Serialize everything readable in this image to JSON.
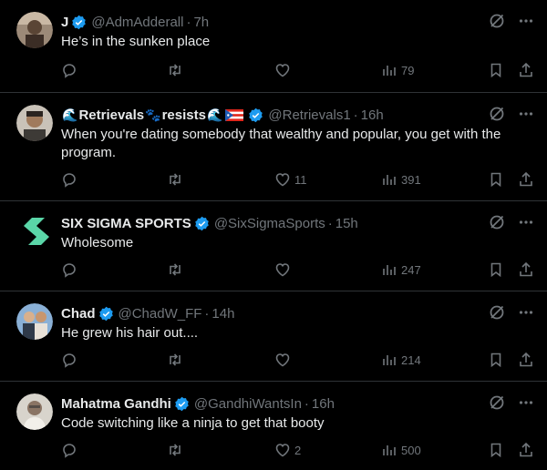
{
  "tweets": [
    {
      "name": "J",
      "handle": "@AdmAdderall",
      "time": "7h",
      "text": "He’s in the sunken place",
      "replies": "",
      "retweets": "",
      "likes": "",
      "views": "79"
    },
    {
      "name_emoji_1": "🌊",
      "name_part1": "Retrievals",
      "name_emoji_2": "🐾",
      "name_part2": "resists",
      "name_emoji_3": "🌊",
      "handle": "@Retrievals1",
      "time": "16h",
      "text": "When you're dating somebody that wealthy and popular, you get with the program.",
      "replies": "",
      "retweets": "",
      "likes": "11",
      "views": "391"
    },
    {
      "name": "SIX SIGMA SPORTS",
      "handle": "@SixSigmaSports",
      "time": "15h",
      "text": "Wholesome",
      "replies": "",
      "retweets": "",
      "likes": "",
      "views": "247"
    },
    {
      "name": "Chad",
      "handle": "@ChadW_FF",
      "time": "14h",
      "text": "He grew his hair out....",
      "replies": "",
      "retweets": "",
      "likes": "",
      "views": "214"
    },
    {
      "name": "Mahatma Gandhi",
      "handle": "@GandhiWantsIn",
      "time": "16h",
      "text": "Code switching like a ninja to get that booty",
      "replies": "",
      "retweets": "",
      "likes": "2",
      "views": "500"
    }
  ],
  "separator": "·",
  "icons": {
    "verified": "verified-badge-icon",
    "grok": "grok-icon",
    "more": "more-icon",
    "reply": "reply-icon",
    "retweet": "retweet-icon",
    "like": "like-icon",
    "views": "views-icon",
    "bookmark": "bookmark-icon",
    "share": "share-icon"
  },
  "colors": {
    "background": "#000000",
    "text": "#e7e9ea",
    "muted": "#71767b",
    "verified": "#1d9bf0",
    "divider": "#2f3336"
  }
}
